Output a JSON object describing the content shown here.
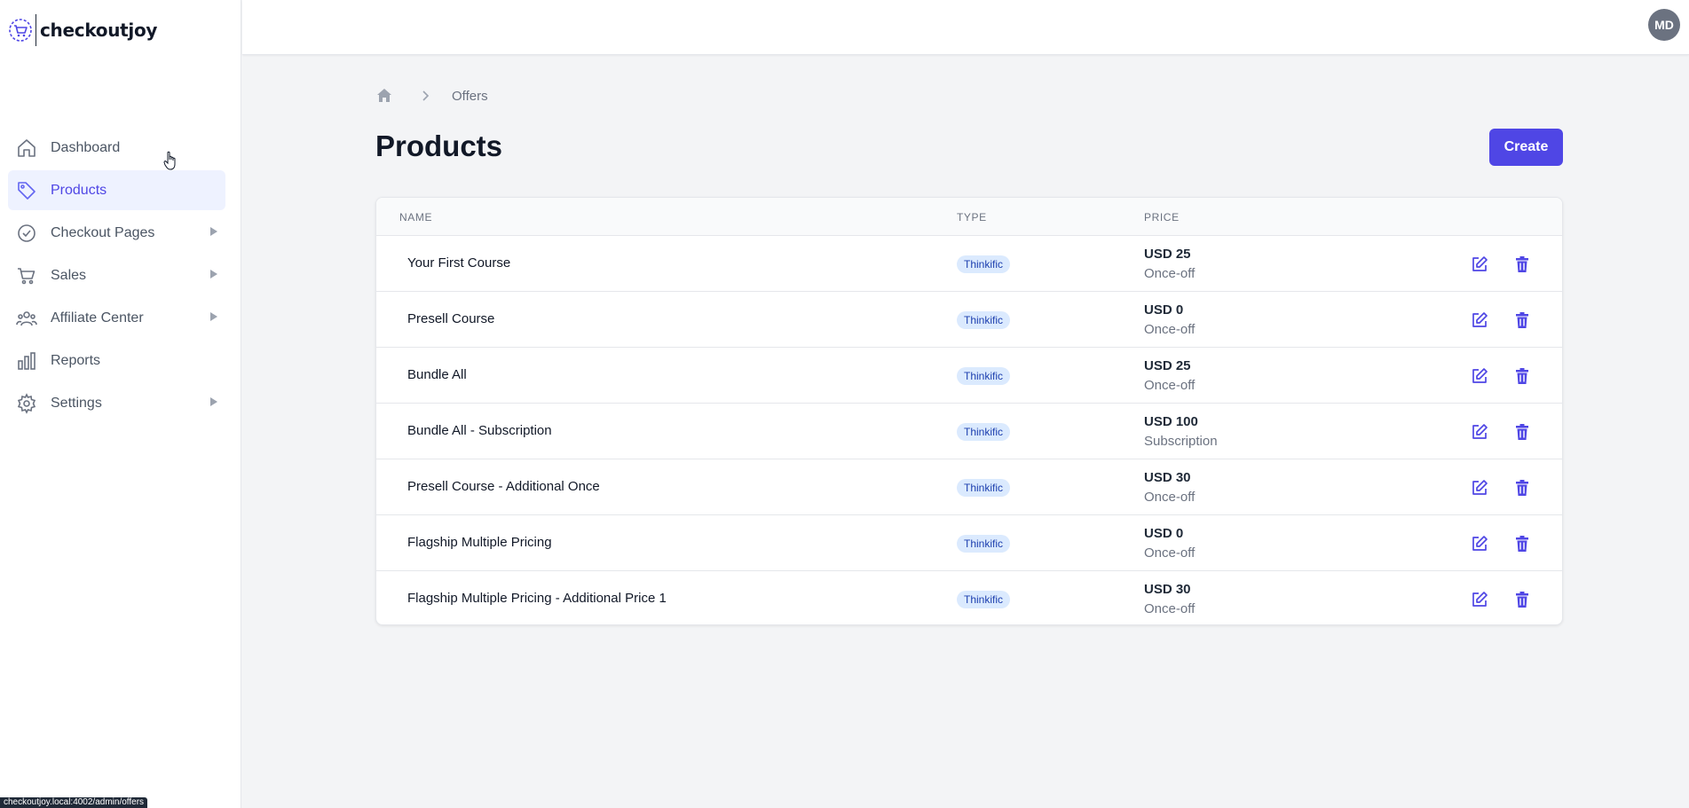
{
  "app": {
    "brand": "checkoutjoy",
    "accent": "#4f46e5",
    "avatar_initials": "MD"
  },
  "sidebar": {
    "items": [
      {
        "label": "Dashboard",
        "icon": "home-icon",
        "active": false,
        "has_submenu": false
      },
      {
        "label": "Products",
        "icon": "tag-icon",
        "active": true,
        "has_submenu": false
      },
      {
        "label": "Checkout Pages",
        "icon": "check-circle-icon",
        "active": false,
        "has_submenu": true
      },
      {
        "label": "Sales",
        "icon": "cart-icon",
        "active": false,
        "has_submenu": true
      },
      {
        "label": "Affiliate Center",
        "icon": "users-icon",
        "active": false,
        "has_submenu": true
      },
      {
        "label": "Reports",
        "icon": "bar-chart-icon",
        "active": false,
        "has_submenu": false
      },
      {
        "label": "Settings",
        "icon": "gear-icon",
        "active": false,
        "has_submenu": true
      }
    ]
  },
  "breadcrumb": {
    "items": [
      "Offers"
    ]
  },
  "page": {
    "title": "Products",
    "create_label": "Create"
  },
  "table": {
    "headers": [
      "NAME",
      "TYPE",
      "PRICE"
    ],
    "rows": [
      {
        "name": "Your First Course",
        "type": "Thinkific",
        "price": "USD 25",
        "term": "Once-off"
      },
      {
        "name": "Presell Course",
        "type": "Thinkific",
        "price": "USD 0",
        "term": "Once-off"
      },
      {
        "name": "Bundle All",
        "type": "Thinkific",
        "price": "USD 25",
        "term": "Once-off"
      },
      {
        "name": "Bundle All - Subscription",
        "type": "Thinkific",
        "price": "USD 100",
        "term": "Subscription"
      },
      {
        "name": "Presell Course - Additional Once",
        "type": "Thinkific",
        "price": "USD 30",
        "term": "Once-off"
      },
      {
        "name": "Flagship Multiple Pricing",
        "type": "Thinkific",
        "price": "USD 0",
        "term": "Once-off"
      },
      {
        "name": "Flagship Multiple Pricing - Additional Price 1",
        "type": "Thinkific",
        "price": "USD 30",
        "term": "Once-off"
      }
    ]
  },
  "status_bar": {
    "url": "checkoutjoy.local:4002/admin/offers"
  }
}
